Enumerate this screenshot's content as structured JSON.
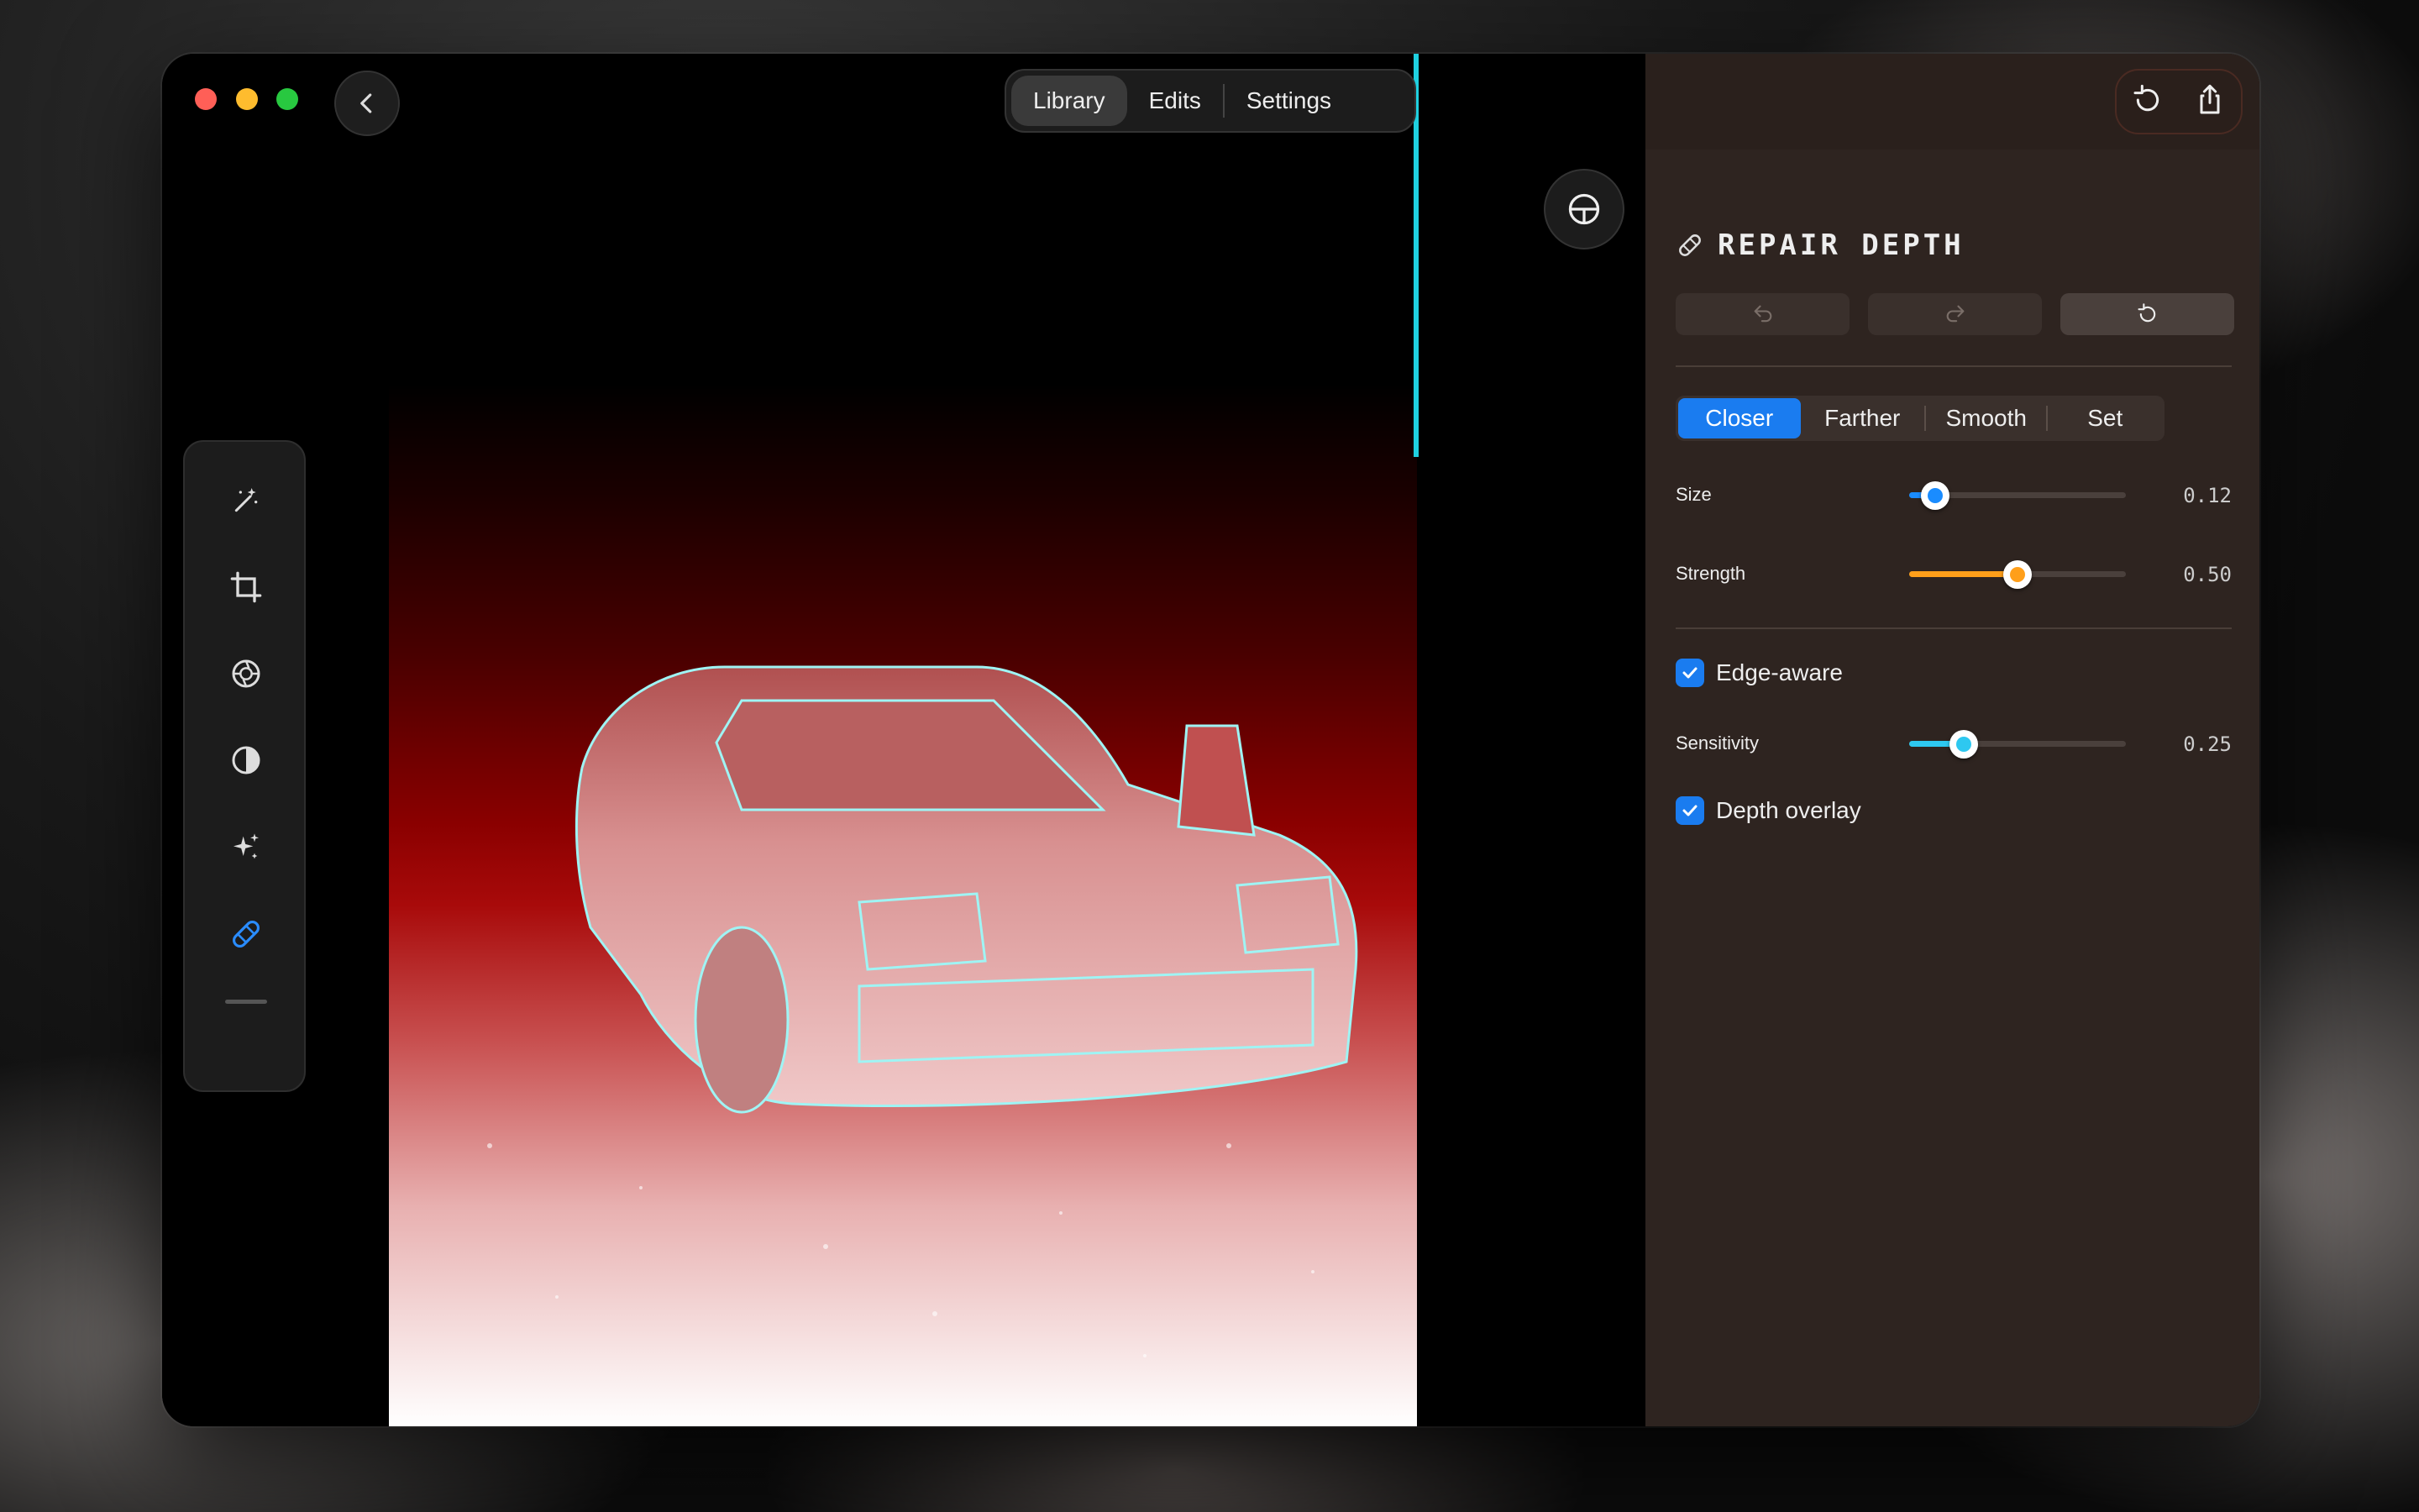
{
  "window": {
    "traffic_lights": {
      "close": "#ff5f57",
      "minimize": "#febc2e",
      "zoom": "#28c840"
    }
  },
  "header": {
    "tabs": [
      {
        "label": "Library",
        "active": true
      },
      {
        "label": "Edits",
        "active": false
      },
      {
        "label": "Settings",
        "active": false
      }
    ]
  },
  "toolbar": {
    "tools": [
      {
        "icon": "magic-wand-icon",
        "active": false
      },
      {
        "icon": "crop-icon",
        "active": false
      },
      {
        "icon": "aperture-icon",
        "active": false
      },
      {
        "icon": "contrast-icon",
        "active": false
      },
      {
        "icon": "sparkles-icon",
        "active": false
      },
      {
        "icon": "bandage-icon",
        "active": true
      }
    ]
  },
  "panel": {
    "title": "REPAIR DEPTH",
    "modes": [
      {
        "label": "Closer",
        "active": true
      },
      {
        "label": "Farther",
        "active": false
      },
      {
        "label": "Smooth",
        "active": false
      },
      {
        "label": "Set",
        "active": false
      }
    ],
    "size": {
      "label": "Size",
      "value": 0.12,
      "display": "0.12",
      "color": "#1a8cff"
    },
    "strength": {
      "label": "Strength",
      "value": 0.5,
      "display": "0.50",
      "color": "#ff9f1a"
    },
    "edge_aware": {
      "label": "Edge-aware",
      "checked": true
    },
    "sensitivity": {
      "label": "Sensitivity",
      "value": 0.25,
      "display": "0.25",
      "color": "#2ec8f0"
    },
    "depth_overlay": {
      "label": "Depth overlay",
      "checked": true
    }
  },
  "colors": {
    "accent": "#1a7cf0",
    "cursor_line": "#1fd0e0",
    "panel_bg": "#2e2420"
  }
}
